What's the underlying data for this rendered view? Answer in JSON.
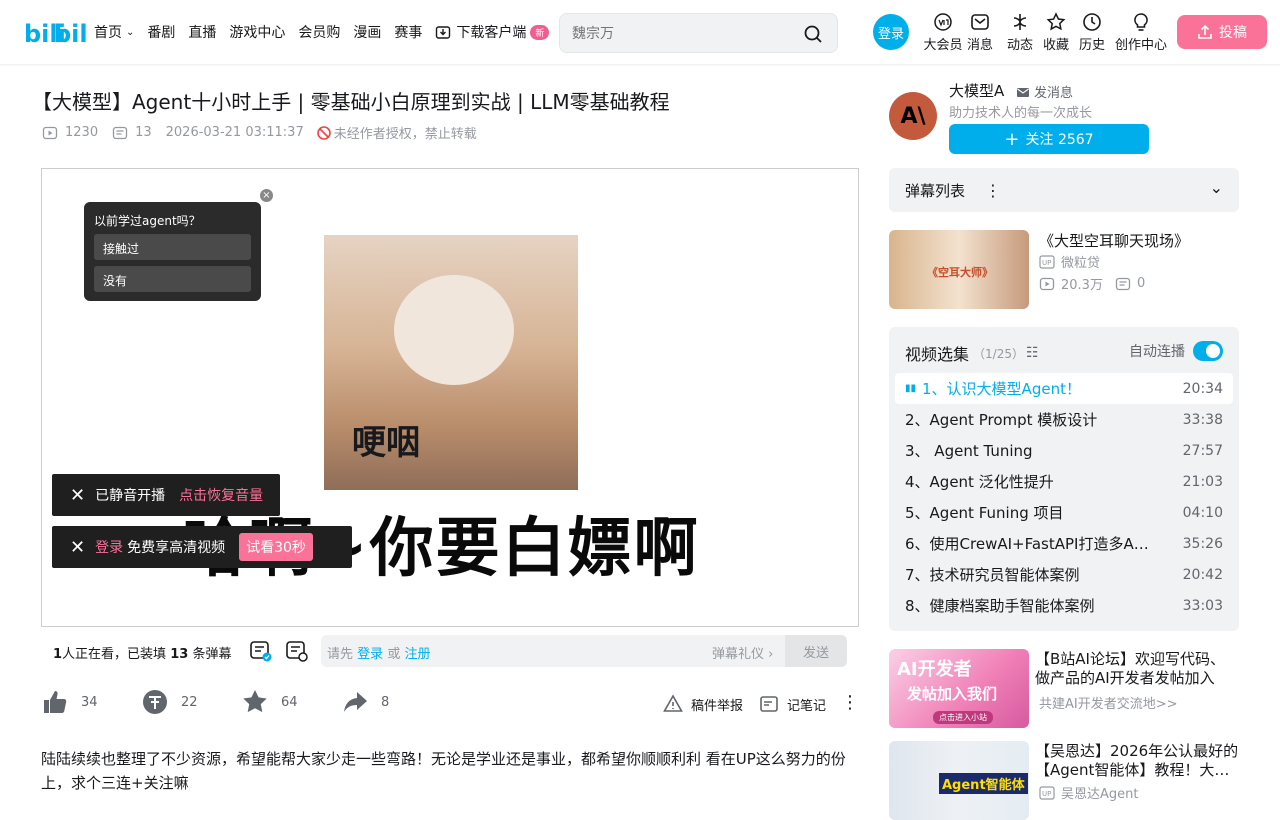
{
  "header": {
    "nav": [
      "首页",
      "番剧",
      "直播",
      "游戏中心",
      "会员购",
      "漫画",
      "赛事",
      "下载客户端"
    ],
    "new_badge": "新",
    "search_placeholder": "魏宗万",
    "login": "登录",
    "right_icons": [
      "大会员",
      "消息",
      "动态",
      "收藏",
      "历史",
      "创作中心"
    ],
    "upload": "投稿"
  },
  "video": {
    "title": "【大模型】Agent十小时上手 | 零基础小白原理到实战 | LLM零基础教程",
    "views": "1230",
    "danmaku": "13",
    "date": "2026-03-21 03:11:37",
    "notice": "未经作者授权，禁止转载"
  },
  "player": {
    "poll_question": "以前学过agent吗？",
    "poll_options": [
      "接触过",
      "没有"
    ],
    "meme_text_small": "哽咽",
    "meme_text_big": "哈啊~你要白嫖啊",
    "toast_muted": "已静音开播",
    "toast_muted_action": "点击恢复音量",
    "toast_login": "登录",
    "toast_hd": "免费享高清视频",
    "toast_try": "试看30秒"
  },
  "danmaku_bar": {
    "watching": "1",
    "watching_label": "人正在看，已装填",
    "count": "13",
    "count_label": "条弹幕",
    "input_prefix": "请先",
    "input_login": "登录",
    "input_or": "或",
    "input_register": "注册",
    "gift": "弹幕礼仪",
    "send": "发送"
  },
  "actions": {
    "like": "34",
    "coin": "22",
    "fav": "64",
    "share": "8",
    "report": "稿件举报",
    "notes": "记笔记"
  },
  "description": "陆陆续续也整理了不少资源，希望能帮大家少走一些弯路！无论是学业还是事业，都希望你顺顺利利 看在UP这么努力的份上，求个三连+关注嘛",
  "uploader": {
    "name": "大模型A",
    "message": "发消息",
    "sign": "助力技术人的每一次成长",
    "follow": "关注 2567",
    "avatar_text": "A\\"
  },
  "danmaku_list": "弹幕列表",
  "rec1": {
    "title": "《大型空耳聊天现场》",
    "author": "微粒贷",
    "views": "20.3万",
    "danmaku": "0",
    "thumb_text": "《空耳大师》"
  },
  "episodes": {
    "header": "视频选集",
    "progress": "（1/25）",
    "autoplay": "自动连播",
    "items": [
      {
        "name": "1、认识大模型Agent！",
        "dur": "20:34"
      },
      {
        "name": "2、Agent Prompt 模板设计",
        "dur": "33:38"
      },
      {
        "name": "3、 Agent Tuning",
        "dur": "27:57"
      },
      {
        "name": "4、Agent 泛化性提升",
        "dur": "21:03"
      },
      {
        "name": "5、Agent Funing 项目",
        "dur": "04:10"
      },
      {
        "name": "6、使用CrewAI+FastAPI打造多Agent…",
        "dur": "35:26"
      },
      {
        "name": "7、技术研究员智能体案例",
        "dur": "20:42"
      },
      {
        "name": "8、健康档案助手智能体案例",
        "dur": "33:03"
      }
    ]
  },
  "rec2": {
    "title": "【B站AI论坛】欢迎写代码、做产品的AI开发者发帖加入",
    "sub": "共建AI开发者交流地>>",
    "thumb_line1": "AI开发者",
    "thumb_line2": "发帖加入我们",
    "thumb_btn": "点击进入小站"
  },
  "rec3": {
    "title": "【吴恩达】2026年公认最好的【Agent智能体】教程！大…",
    "author": "吴恩达Agent",
    "thumb_text": "Agent智能体"
  }
}
